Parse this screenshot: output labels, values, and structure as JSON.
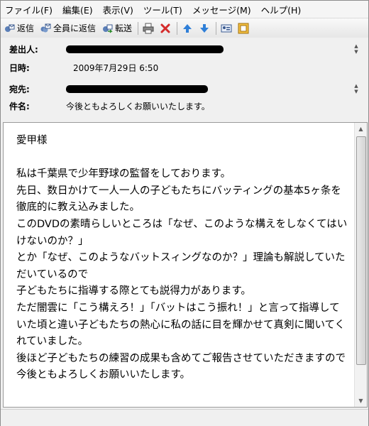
{
  "menu": [
    "ファイル(F)",
    "編集(E)",
    "表示(V)",
    "ツール(T)",
    "メッセージ(M)",
    "ヘルプ(H)"
  ],
  "toolbar": {
    "reply": "返信",
    "reply_all": "全員に返信",
    "forward": "転送"
  },
  "header": {
    "from_label": "差出人:",
    "date_label": "日時:",
    "date_value": "2009年7月29日 6:50",
    "to_label": "宛先:",
    "subject_label": "件名:",
    "subject_value": "今後ともよろしくお願いいたします。"
  },
  "body": {
    "text": "愛甲様\n\n私は千葉県で少年野球の監督をしております。\n先日、数日かけて一人一人の子どもたちにバッティングの基本5ヶ条を徹底的に教え込みました。\nこのDVDの素晴らしいところは「なぜ、このような構えをしなくてはいけないのか？」\nとか「なぜ、このようなバットスィングなのか？」理論も解説していただいているので\n子どもたちに指導する際とても説得力があります。\nただ闇雲に「こう構えろ！」「バットはこう振れ！」と言って指導していた頃と違い子どもたちの熱心に私の話に目を輝かせて真剣に聞いてくれていました。\n後ほど子どもたちの練習の成果も含めてご報告させていただきますので今後ともよろしくお願いいたします。"
  }
}
